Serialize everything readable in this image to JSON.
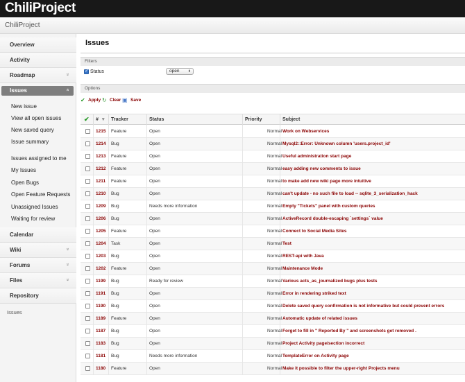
{
  "app": {
    "logo": "ChiliProject",
    "project": "ChiliProject"
  },
  "sidebar": {
    "menu": [
      {
        "label": "Overview",
        "expandable": false
      },
      {
        "label": "Activity",
        "expandable": false
      },
      {
        "label": "Roadmap",
        "expandable": true
      },
      {
        "label": "Issues",
        "expandable": true,
        "active": true
      },
      {
        "label": "Calendar",
        "expandable": false
      },
      {
        "label": "Wiki",
        "expandable": true
      },
      {
        "label": "Forums",
        "expandable": true
      },
      {
        "label": "Files",
        "expandable": true
      },
      {
        "label": "Repository",
        "expandable": false
      }
    ],
    "issue_links": [
      "New issue",
      "View all open issues",
      "New saved query",
      "Issue summary"
    ],
    "saved_queries": [
      "Issues assigned to me",
      "My Issues",
      "Open Bugs",
      "Open Feature Requests",
      "Unassigned Issues",
      "Waiting for review"
    ],
    "footer": "Issues",
    "chevron_glyph": "»"
  },
  "main": {
    "title": "Issues",
    "filters": {
      "label": "Filters",
      "status_label": "Status",
      "status_value": "open",
      "select_arrow": "⬍"
    },
    "options_label": "Options",
    "actions": {
      "apply": "Apply",
      "clear": "Clear",
      "save": "Save"
    },
    "table": {
      "columns": {
        "id": "#",
        "sort_arrow": "▾",
        "tracker": "Tracker",
        "status": "Status",
        "priority": "Priority",
        "subject": "Subject"
      },
      "rows": [
        {
          "id": "1215",
          "tracker": "Feature",
          "status": "Open",
          "priority": "Normal",
          "subject": "Work on Webservices"
        },
        {
          "id": "1214",
          "tracker": "Bug",
          "status": "Open",
          "priority": "Normal",
          "subject": "Mysql2::Error: Unknown column 'users.project_id'"
        },
        {
          "id": "1213",
          "tracker": "Feature",
          "status": "Open",
          "priority": "Normal",
          "subject": "Useful administration start page"
        },
        {
          "id": "1212",
          "tracker": "Feature",
          "status": "Open",
          "priority": "Normal",
          "subject": "easy adding new comments to issue"
        },
        {
          "id": "1211",
          "tracker": "Feature",
          "status": "Open",
          "priority": "Normal",
          "subject": "to make add new wiki page more intuitive"
        },
        {
          "id": "1210",
          "tracker": "Bug",
          "status": "Open",
          "priority": "Normal",
          "subject": "can't update - no such file to load -- sqlite_3_serialization_hack"
        },
        {
          "id": "1209",
          "tracker": "Bug",
          "status": "Needs more information",
          "priority": "Normal",
          "subject": "Empty \"Tickets\" panel with custom queries"
        },
        {
          "id": "1206",
          "tracker": "Bug",
          "status": "Open",
          "priority": "Normal",
          "subject": "ActiveRecord double-escaping `settings` value"
        },
        {
          "id": "1205",
          "tracker": "Feature",
          "status": "Open",
          "priority": "Normal",
          "subject": "Connect to Social Media Sites"
        },
        {
          "id": "1204",
          "tracker": "Task",
          "status": "Open",
          "priority": "Normal",
          "subject": "Test"
        },
        {
          "id": "1203",
          "tracker": "Bug",
          "status": "Open",
          "priority": "Normal",
          "subject": "REST-api with Java"
        },
        {
          "id": "1202",
          "tracker": "Feature",
          "status": "Open",
          "priority": "Normal",
          "subject": "Maintenance Mode"
        },
        {
          "id": "1199",
          "tracker": "Bug",
          "status": "Ready for review",
          "priority": "Normal",
          "subject": "Various acts_as_journalized bugs plus tests"
        },
        {
          "id": "1191",
          "tracker": "Bug",
          "status": "Open",
          "priority": "Normal",
          "subject": "Error in rendering striked text"
        },
        {
          "id": "1190",
          "tracker": "Bug",
          "status": "Open",
          "priority": "Normal",
          "subject": "Delete saved query confirmation is not informative but could prevent errors"
        },
        {
          "id": "1189",
          "tracker": "Feature",
          "status": "Open",
          "priority": "Normal",
          "subject": "Automatic update of related issues"
        },
        {
          "id": "1187",
          "tracker": "Bug",
          "status": "Open",
          "priority": "Normal",
          "subject": "Forget to fill in \" Reported By \" and screenshots get removed ."
        },
        {
          "id": "1183",
          "tracker": "Bug",
          "status": "Open",
          "priority": "Normal",
          "subject": "Project Activity page/section incorrect"
        },
        {
          "id": "1181",
          "tracker": "Bug",
          "status": "Needs more information",
          "priority": "Normal",
          "subject": "TemplateError on Activity page"
        },
        {
          "id": "1180",
          "tracker": "Feature",
          "status": "Open",
          "priority": "Normal",
          "subject": "Make it possible to filter the upper-right Projects menu"
        }
      ]
    }
  },
  "colors": {
    "link": "#8a0000",
    "topbar": "#181818",
    "active_menu": "#7e7e7e"
  }
}
